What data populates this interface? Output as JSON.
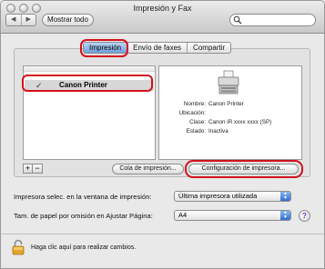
{
  "window": {
    "title": "Impresión y Fax"
  },
  "toolbar": {
    "back_label": "◀",
    "forward_label": "▶",
    "show_all_label": "Mostrar todo",
    "search_placeholder": ""
  },
  "tabs": [
    {
      "label": "Impresión",
      "active": true
    },
    {
      "label": "Envío de faxes",
      "active": false
    },
    {
      "label": "Compartir",
      "active": false
    }
  ],
  "printers": [
    {
      "name": "Canon Printer",
      "checked": true
    }
  ],
  "details": {
    "fields": [
      {
        "key": "Nombre:",
        "value": "Canon Printer"
      },
      {
        "key": "Ubicación:",
        "value": ""
      },
      {
        "key": "Clase:",
        "value": "Canon iR  xxxx  xxxx (SP)"
      },
      {
        "key": "Estado:",
        "value": "Inactiva"
      }
    ]
  },
  "list_controls": {
    "add_label": "+",
    "remove_label": "−"
  },
  "buttons": {
    "queue_label": "Cola de impresión...",
    "config_label": "Configuración de impresora..."
  },
  "settings": {
    "selected_printer_label": "Impresora selec. en la ventana de impresión:",
    "selected_printer_value": "Última impresora utilizada",
    "paper_size_label": "Tam. de papel por omisión en Ajustar Página:",
    "paper_size_value": "A4"
  },
  "footer": {
    "lock_text": "Haga clic aquí para realizar cambios."
  },
  "colors": {
    "highlight": "#d4101e",
    "active_tab": "#6d9fdc",
    "popup_arrow": "#2f6fd0"
  }
}
